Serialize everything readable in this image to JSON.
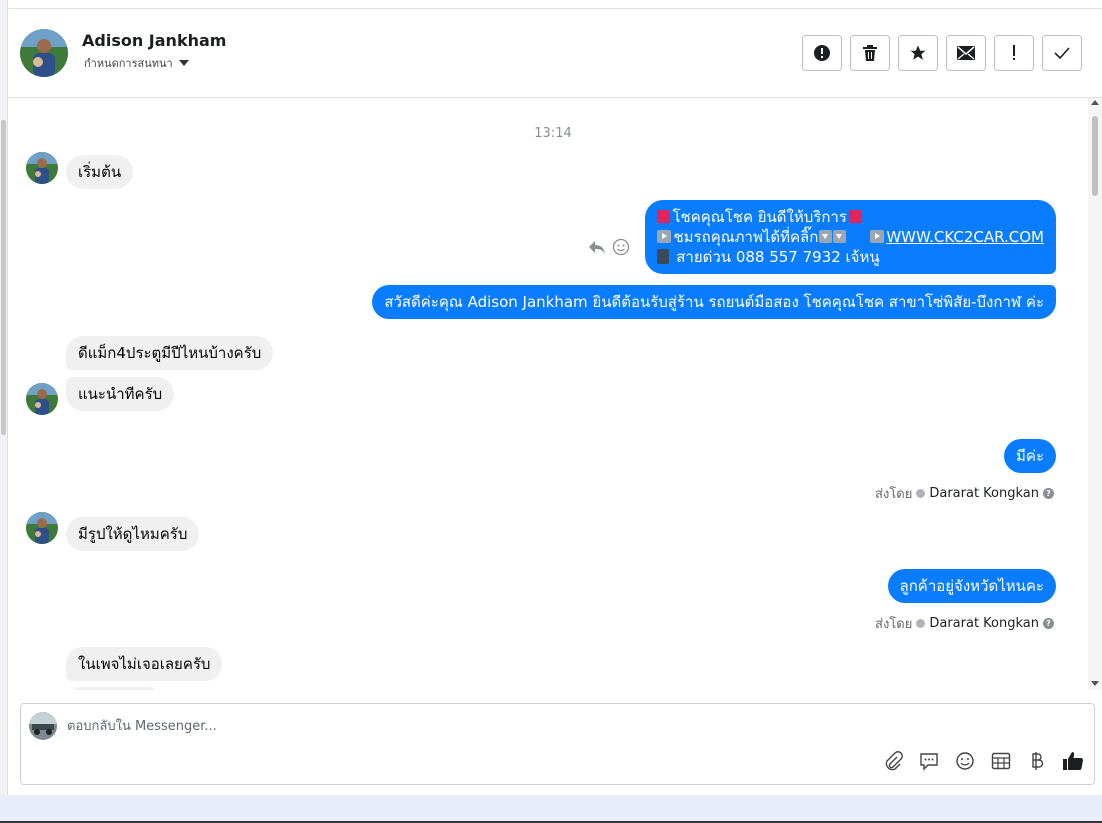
{
  "header": {
    "contact_name": "Adison Jankham",
    "subtitle": "กำหนดการสนทนา",
    "actions": [
      {
        "name": "report-button",
        "icon": "alert-circle-icon"
      },
      {
        "name": "delete-button",
        "icon": "trash-icon"
      },
      {
        "name": "star-button",
        "icon": "star-icon"
      },
      {
        "name": "mark-unread-button",
        "icon": "envelope-icon"
      },
      {
        "name": "mark-spam-button",
        "icon": "exclamation-icon"
      },
      {
        "name": "mark-done-button",
        "icon": "checkmark-icon"
      }
    ]
  },
  "conversation": {
    "timestamp": "13:14",
    "messages": [
      {
        "id": "m1",
        "direction": "in",
        "text": "เริ่มต้น"
      },
      {
        "id": "m2",
        "direction": "out",
        "line1": "โชคคุณโชค ยินดีให้บริการ",
        "line2a": "ชมรถคุณภาพได้ที่คลิ๊ก",
        "link": "WWW.CKC2CAR.COM",
        "line3": "สายด่วน 088 557 7932 เจ้หนู"
      },
      {
        "id": "m3",
        "direction": "out",
        "text": "สวัสดีค่ะคุณ Adison Jankham ยินดีต้อนรับสู่ร้าน รถยนต์มือสอง โชคคุณโชค สาขาโซ่พิสัย-บึงกาฬ ค่ะ"
      },
      {
        "id": "m4",
        "direction": "in",
        "text": "ดีแม็ก4ประตูมีปีไหนบ้างครับ"
      },
      {
        "id": "m5",
        "direction": "in",
        "text": "แนะนำทีครับ"
      },
      {
        "id": "m6",
        "direction": "out",
        "text": "มีค่ะ"
      },
      {
        "id": "m7",
        "direction": "in",
        "text": "มีรูปให้ดูไหมครับ"
      },
      {
        "id": "m8",
        "direction": "out",
        "text": "ลูกค้าอยู่จังหวัดไหนคะ"
      },
      {
        "id": "m9",
        "direction": "in",
        "text": "ในเพจไม่เจอเลยครับ"
      }
    ],
    "sent_by_prefix": "ส่งโดย",
    "sent_by_name": "Dararat Kongkan"
  },
  "composer": {
    "placeholder": "ตอบกลับใน Messenger...",
    "tools": [
      "paperclip-icon",
      "chat-bubble-icon",
      "smiley-icon",
      "table-icon",
      "baht-icon",
      "thumbs-up-icon"
    ]
  },
  "colors": {
    "outgoing_bubble": "#0a7cff",
    "incoming_bubble": "#f0f0f0",
    "accent": "#0a7cff"
  }
}
